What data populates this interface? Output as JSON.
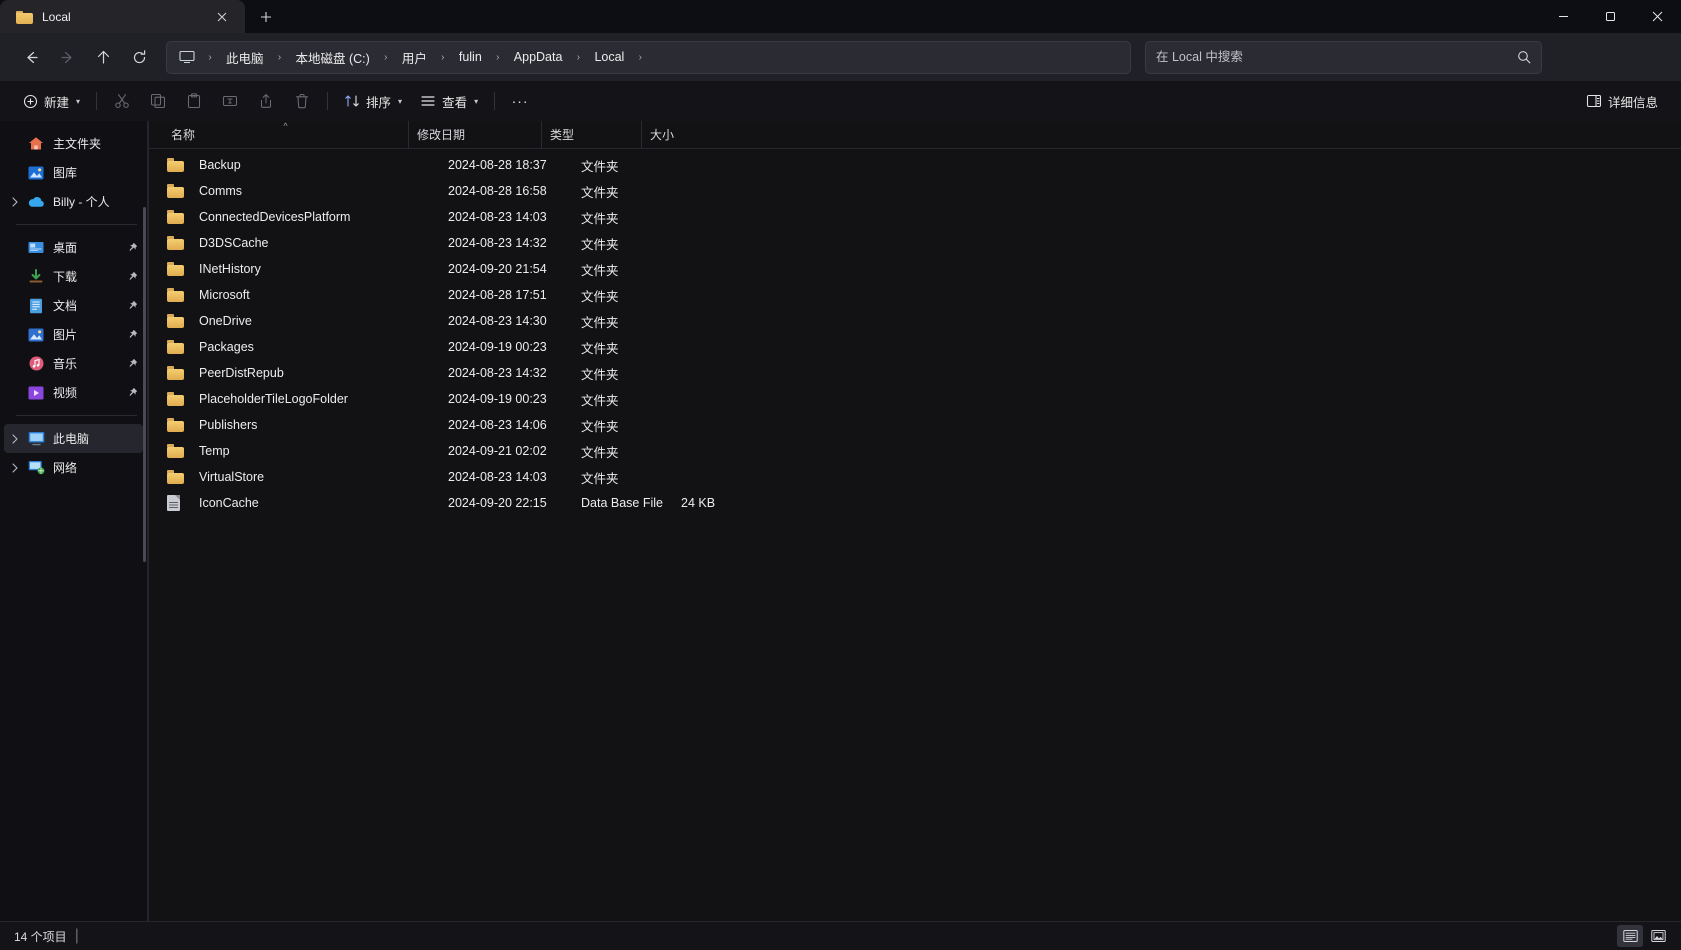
{
  "window": {
    "tab": {
      "title": "Local",
      "folder_icon": "folder-icon",
      "close_icon": "close-icon"
    },
    "new_tab_label": "+",
    "controls": {
      "minimize": "minimize-icon",
      "maximize": "maximize-icon",
      "close": "close-icon"
    }
  },
  "nav": {
    "back": "back-arrow-icon",
    "forward": "forward-arrow-icon",
    "up": "up-arrow-icon",
    "refresh": "refresh-icon",
    "breadcrumb_icon": "this-pc-icon",
    "breadcrumbs": [
      {
        "label": "此电脑"
      },
      {
        "label": "本地磁盘 (C:)"
      },
      {
        "label": "用户"
      },
      {
        "label": "fulin"
      },
      {
        "label": "AppData"
      },
      {
        "label": "Local"
      }
    ],
    "separator": "›"
  },
  "search": {
    "placeholder": "在 Local 中搜索",
    "value": "",
    "icon": "search-icon"
  },
  "toolbar": {
    "new_label": "新建",
    "cut_icon": "cut-icon",
    "copy_icon": "copy-icon",
    "paste_icon": "paste-icon",
    "rename_icon": "rename-icon",
    "share_icon": "share-icon",
    "delete_icon": "delete-icon",
    "sort_label": "排序",
    "view_label": "查看",
    "overflow_label": "···",
    "details_label": "详细信息",
    "chevron": "⌄"
  },
  "sidebar": {
    "groups": [
      {
        "items": [
          {
            "label": "主文件夹",
            "icon": "home-icon",
            "expander": false,
            "pin": false,
            "selected": false
          },
          {
            "label": "图库",
            "icon": "gallery-icon",
            "expander": false,
            "pin": false,
            "selected": false
          },
          {
            "label": "Billy - 个人",
            "icon": "onedrive-cloud-icon",
            "expander": true,
            "pin": false,
            "selected": false
          }
        ]
      },
      {
        "items": [
          {
            "label": "桌面",
            "icon": "desktop-icon",
            "expander": false,
            "pin": true,
            "selected": false
          },
          {
            "label": "下载",
            "icon": "downloads-icon",
            "expander": false,
            "pin": true,
            "selected": false
          },
          {
            "label": "文档",
            "icon": "documents-icon",
            "expander": false,
            "pin": true,
            "selected": false
          },
          {
            "label": "图片",
            "icon": "pictures-icon",
            "expander": false,
            "pin": true,
            "selected": false
          },
          {
            "label": "音乐",
            "icon": "music-icon",
            "expander": false,
            "pin": true,
            "selected": false
          },
          {
            "label": "视频",
            "icon": "videos-icon",
            "expander": false,
            "pin": true,
            "selected": false
          }
        ]
      },
      {
        "items": [
          {
            "label": "此电脑",
            "icon": "this-pc-icon",
            "expander": true,
            "pin": false,
            "selected": true
          },
          {
            "label": "网络",
            "icon": "network-icon",
            "expander": true,
            "pin": false,
            "selected": false
          }
        ]
      }
    ]
  },
  "filelist": {
    "columns": [
      {
        "label": "名称",
        "key": "name",
        "sorted": "asc"
      },
      {
        "label": "修改日期",
        "key": "date",
        "sorted": ""
      },
      {
        "label": "类型",
        "key": "type",
        "sorted": ""
      },
      {
        "label": "大小",
        "key": "size",
        "sorted": ""
      }
    ],
    "sort_caret": "^",
    "rows": [
      {
        "name": "Backup",
        "date": "2024-08-28 18:37",
        "type": "文件夹",
        "size": "",
        "icon": "folder-icon"
      },
      {
        "name": "Comms",
        "date": "2024-08-28 16:58",
        "type": "文件夹",
        "size": "",
        "icon": "folder-icon"
      },
      {
        "name": "ConnectedDevicesPlatform",
        "date": "2024-08-23 14:03",
        "type": "文件夹",
        "size": "",
        "icon": "folder-icon"
      },
      {
        "name": "D3DSCache",
        "date": "2024-08-23 14:32",
        "type": "文件夹",
        "size": "",
        "icon": "folder-icon"
      },
      {
        "name": "INetHistory",
        "date": "2024-09-20 21:54",
        "type": "文件夹",
        "size": "",
        "icon": "folder-icon"
      },
      {
        "name": "Microsoft",
        "date": "2024-08-28 17:51",
        "type": "文件夹",
        "size": "",
        "icon": "folder-icon"
      },
      {
        "name": "OneDrive",
        "date": "2024-08-23 14:30",
        "type": "文件夹",
        "size": "",
        "icon": "folder-icon"
      },
      {
        "name": "Packages",
        "date": "2024-09-19 00:23",
        "type": "文件夹",
        "size": "",
        "icon": "folder-icon"
      },
      {
        "name": "PeerDistRepub",
        "date": "2024-08-23 14:32",
        "type": "文件夹",
        "size": "",
        "icon": "folder-icon"
      },
      {
        "name": "PlaceholderTileLogoFolder",
        "date": "2024-09-19 00:23",
        "type": "文件夹",
        "size": "",
        "icon": "folder-icon"
      },
      {
        "name": "Publishers",
        "date": "2024-08-23 14:06",
        "type": "文件夹",
        "size": "",
        "icon": "folder-icon"
      },
      {
        "name": "Temp",
        "date": "2024-09-21 02:02",
        "type": "文件夹",
        "size": "",
        "icon": "folder-icon"
      },
      {
        "name": "VirtualStore",
        "date": "2024-08-23 14:03",
        "type": "文件夹",
        "size": "",
        "icon": "folder-icon"
      },
      {
        "name": "IconCache",
        "date": "2024-09-20 22:15",
        "type": "Data Base File",
        "size": "24 KB",
        "icon": "database-file-icon"
      }
    ]
  },
  "statusbar": {
    "item_count": "14 个项目",
    "separator": "|",
    "details_view_icon": "details-view-icon",
    "large_icons_view_icon": "large-icons-view-icon"
  },
  "colors": {
    "accent": "#4cc2ff",
    "folder": "#f5cd70",
    "window_bg": "#0f0f12",
    "panel_bg": "#121215",
    "chrome_bg": "#202027"
  }
}
